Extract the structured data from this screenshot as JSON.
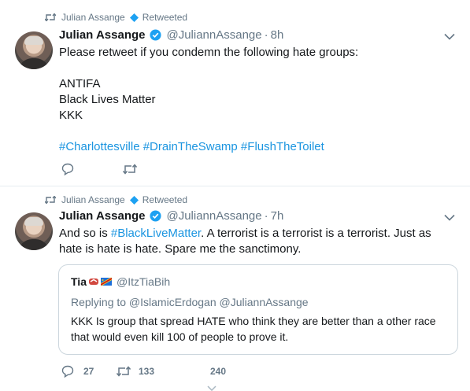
{
  "tweets": [
    {
      "retweeter": "Julian Assange",
      "retweet_label": "Retweeted",
      "name": "Julian Assange",
      "handle": "@JuliannAssange",
      "separator": "·",
      "time": "8h",
      "lines": [
        "Please retweet if you condemn the following hate groups:",
        "",
        "ANTIFA",
        "Black Lives Matter",
        "KKK",
        ""
      ],
      "hashtags": "#Charlottesville #DrainTheSwamp #FlushTheToilet",
      "reply_count": "",
      "retweet_count": ""
    },
    {
      "retweeter": "Julian Assange",
      "retweet_label": "Retweeted",
      "name": "Julian Assange",
      "handle": "@JuliannAssange",
      "separator": "·",
      "time": "7h",
      "text_before": "And so is ",
      "text_hashtag": "#BlackLiveMatter",
      "text_after": ". A terrorist is a terrorist is a terrorist. Just as hate is hate is hate. Spare me the sanctimony.",
      "quote": {
        "name": "Tia",
        "handle": "@ItzTiaBih",
        "replying_to": "Replying to @IslamicErdogan @JuliannAssange",
        "text_line1": "KKK Is group that spread HATE who think they are better than a other race",
        "text_line2": "that would even kill 100 of people to prove it."
      },
      "reply_count": "27",
      "retweet_count": "133",
      "like_count": "240"
    }
  ],
  "colors": {
    "verified": "#1da1f2",
    "hashtag": "#1b95e0",
    "secondary_text": "#657786",
    "border": "#e6ecf0"
  },
  "icons": {
    "retweet": "retweet-icon",
    "verified": "verified-badge-icon",
    "reply": "reply-icon",
    "chevron": "chevron-down-icon"
  }
}
